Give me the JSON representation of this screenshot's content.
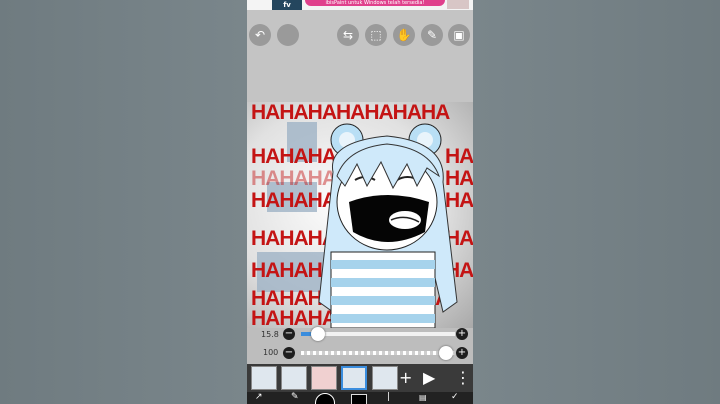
{
  "ad": {
    "logo": "fv",
    "text": "ibisPaint untuk Windows telah tersedia!"
  },
  "canvas": {
    "hahaha_lines": [
      "HAHAHAHAHAHAHA",
      "HAHAHA",
      "HAHAHAH",
      "HAHAHAH",
      "HAHAHA",
      "HAHAHAH",
      "HAHAHAHAHAHAHA",
      "HAHAHA"
    ],
    "hahaha_short": [
      "HA",
      "HA",
      "HA",
      "HA",
      "HA"
    ]
  },
  "sliders": {
    "size_label": "15.8",
    "size_value": 0.13,
    "opacity_label": "100",
    "opacity_value": 1.0
  },
  "layers": {
    "count": 5,
    "selected_index": 3
  },
  "colors": {
    "accent": "#3a8dde",
    "haha_red": "#c41414"
  }
}
